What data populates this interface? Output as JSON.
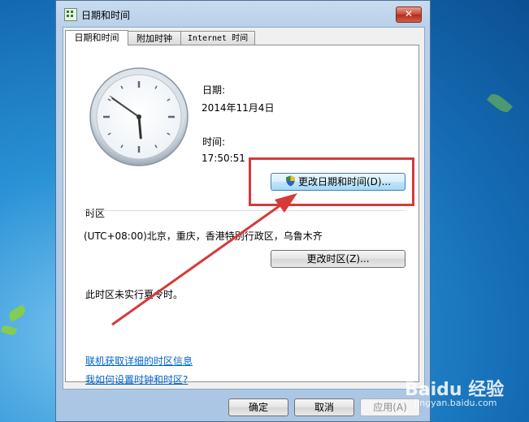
{
  "window": {
    "title": "日期和时间",
    "close_glyph": "✕"
  },
  "tabs": [
    {
      "label": "日期和时间",
      "active": true
    },
    {
      "label": "附加时钟",
      "active": false
    },
    {
      "label": "Internet 时间",
      "active": false
    }
  ],
  "date": {
    "label": "日期:",
    "value": "2014年11月4日"
  },
  "time": {
    "label": "时间:",
    "value": "17:50:51"
  },
  "change_datetime_button": "更改日期和时间(D)...",
  "timezone": {
    "heading": "时区",
    "value": "(UTC+08:00)北京，重庆，香港特别行政区，乌鲁木齐",
    "change_button": "更改时区(Z)...",
    "dst_note": "此时区未实行夏令时。"
  },
  "links": {
    "online_tz_info": "联机获取详细的时区信息",
    "how_to_set": "我如何设置时钟和时区?"
  },
  "footer": {
    "ok": "确定",
    "cancel": "取消",
    "apply": "应用(A)"
  },
  "watermark": {
    "brand": "Baidu 经验",
    "url": "jingyan.baidu.com"
  },
  "colors": {
    "highlight": "#d63a3a",
    "link": "#0066cc"
  }
}
